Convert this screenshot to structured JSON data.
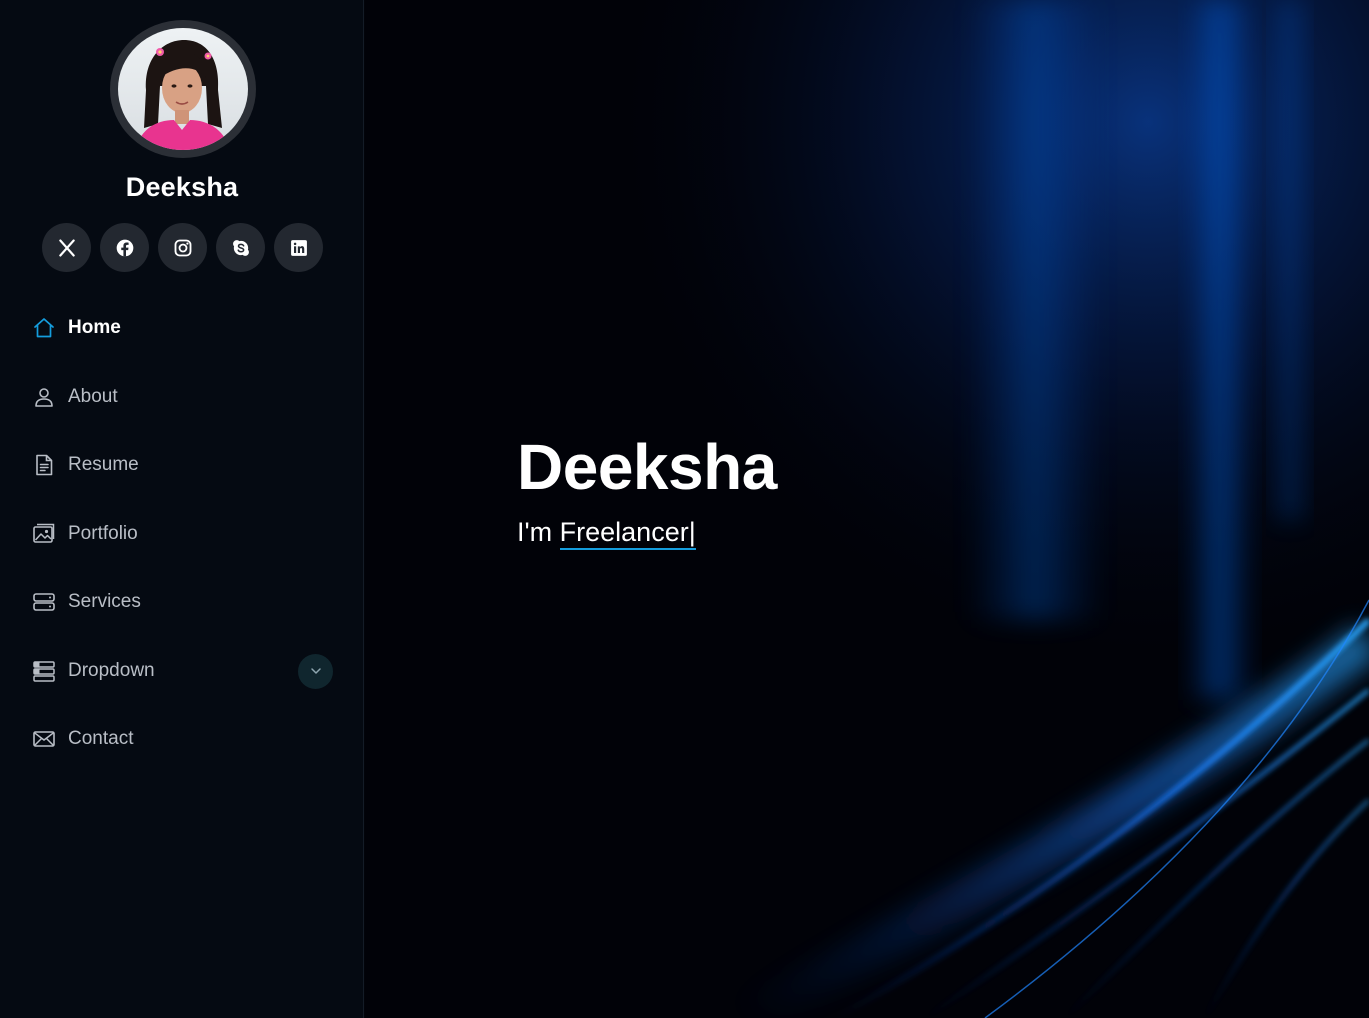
{
  "profile": {
    "name": "Deeksha",
    "avatar": "profile-photo"
  },
  "social": [
    {
      "name": "x-twitter",
      "icon": "x-icon"
    },
    {
      "name": "facebook",
      "icon": "facebook-icon"
    },
    {
      "name": "instagram",
      "icon": "instagram-icon"
    },
    {
      "name": "skype",
      "icon": "skype-icon"
    },
    {
      "name": "linkedin",
      "icon": "linkedin-icon"
    }
  ],
  "nav": {
    "items": [
      {
        "label": "Home",
        "icon": "house-icon",
        "active": true
      },
      {
        "label": "About",
        "icon": "person-icon",
        "active": false
      },
      {
        "label": "Resume",
        "icon": "file-text-icon",
        "active": false
      },
      {
        "label": "Portfolio",
        "icon": "images-icon",
        "active": false
      },
      {
        "label": "Services",
        "icon": "hdd-stack-icon",
        "active": false
      },
      {
        "label": "Dropdown",
        "icon": "menu-stack-icon",
        "active": false,
        "has_dropdown": true
      },
      {
        "label": "Contact",
        "icon": "envelope-icon",
        "active": false
      }
    ]
  },
  "hero": {
    "title": "Deeksha",
    "subtitle_prefix": "I'm ",
    "typed_word": "Freelancer",
    "cursor": "|"
  },
  "colors": {
    "accent": "#149ddd",
    "sidebar_bg": "#050a12",
    "social_bg": "#232830",
    "nav_text": "#b9bec6",
    "hero_bg": "#010208"
  }
}
